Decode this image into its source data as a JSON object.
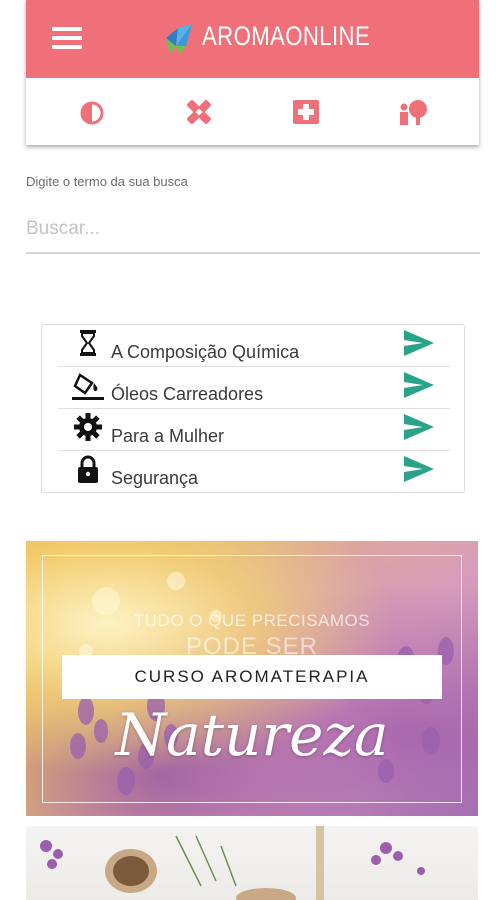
{
  "header": {
    "brand": "AROMAONLINE",
    "menu_icon": "hamburger-menu-icon",
    "nav_icons": [
      "drop-icon",
      "bandage-icon",
      "first-aid-icon",
      "person-plant-icon"
    ],
    "colors": {
      "primary": "#ef7079",
      "accent": "#ef7079"
    }
  },
  "search": {
    "label": "Digite o termo da sua busca",
    "placeholder": "Buscar..."
  },
  "menu": {
    "items": [
      {
        "label": "A Composição Química",
        "icon": "hourglass-icon"
      },
      {
        "label": "Óleos Carreadores",
        "icon": "paint-bucket-icon"
      },
      {
        "label": "Para a Mulher",
        "icon": "gear-icon"
      },
      {
        "label": "Segurança",
        "icon": "lock-icon"
      }
    ],
    "arrow_color": "#2aa388"
  },
  "banner": {
    "tagline": "TUDO O QUE PRECISAMOS",
    "tagline2": "PODE SER",
    "button": "CURSO AROMATERAPIA",
    "script": "Natureza"
  }
}
